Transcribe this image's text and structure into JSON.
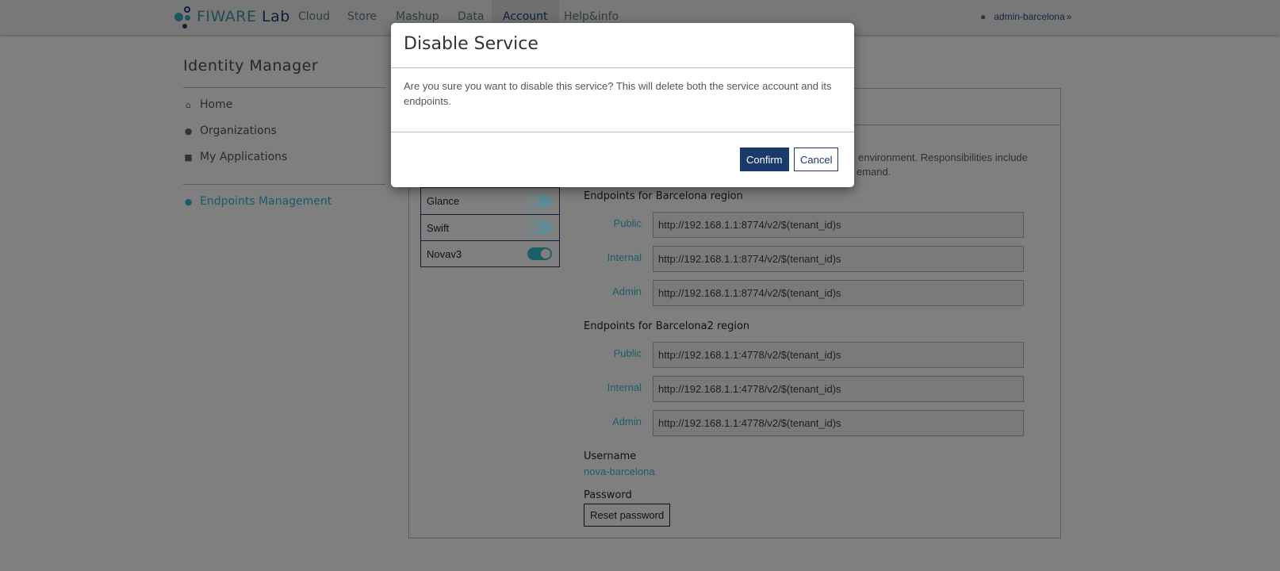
{
  "nav": {
    "logo": "FIWARE Lab",
    "logo_a": "FI",
    "logo_b": "WARE",
    "logo_c": "Lab",
    "items": [
      "Cloud",
      "Store",
      "Mashup",
      "Data",
      "Account",
      "Help&info"
    ],
    "active": "Account",
    "user": "admin-barcelona"
  },
  "sidebar": {
    "title": "Identity Manager",
    "items": [
      {
        "label": "Home",
        "icon": "home-icon"
      },
      {
        "label": "Organizations",
        "icon": "users-icon"
      },
      {
        "label": "My Applications",
        "icon": "cube-icon"
      }
    ],
    "active_item": {
      "label": "Endpoints Management",
      "icon": "globe-icon"
    }
  },
  "services": [
    {
      "name": "Glance",
      "enabled": false
    },
    {
      "name": "Swift",
      "enabled": false
    },
    {
      "name": "Novav3",
      "enabled": true
    }
  ],
  "description_fragments": [
    "environment. Responsibilities include",
    "emand."
  ],
  "regions": [
    {
      "title": "Endpoints for Barcelona region",
      "endpoints": [
        {
          "label": "Public",
          "value": "http://192.168.1.1:8774/v2/$(tenant_id)s"
        },
        {
          "label": "Internal",
          "value": "http://192.168.1.1:8774/v2/$(tenant_id)s"
        },
        {
          "label": "Admin",
          "value": "http://192.168.1.1:8774/v2/$(tenant_id)s"
        }
      ]
    },
    {
      "title": "Endpoints for Barcelona2 region",
      "endpoints": [
        {
          "label": "Public",
          "value": "http://192.168.1.1:4778/v2/$(tenant_id)s"
        },
        {
          "label": "Internal",
          "value": "http://192.168.1.1:4778/v2/$(tenant_id)s"
        },
        {
          "label": "Admin",
          "value": "http://192.168.1.1:4778/v2/$(tenant_id)s"
        }
      ]
    }
  ],
  "account": {
    "username_label": "Username",
    "username": "nova-barcelona",
    "password_label": "Password",
    "reset_label": "Reset password"
  },
  "modal": {
    "title": "Disable Service",
    "body": "Are you sure you want to disable this service? This will delete both the service account and its endpoints.",
    "confirm": "Confirm",
    "cancel": "Cancel"
  },
  "colors": {
    "primary": "#1a3a6c",
    "teal": "#2b8a96"
  }
}
